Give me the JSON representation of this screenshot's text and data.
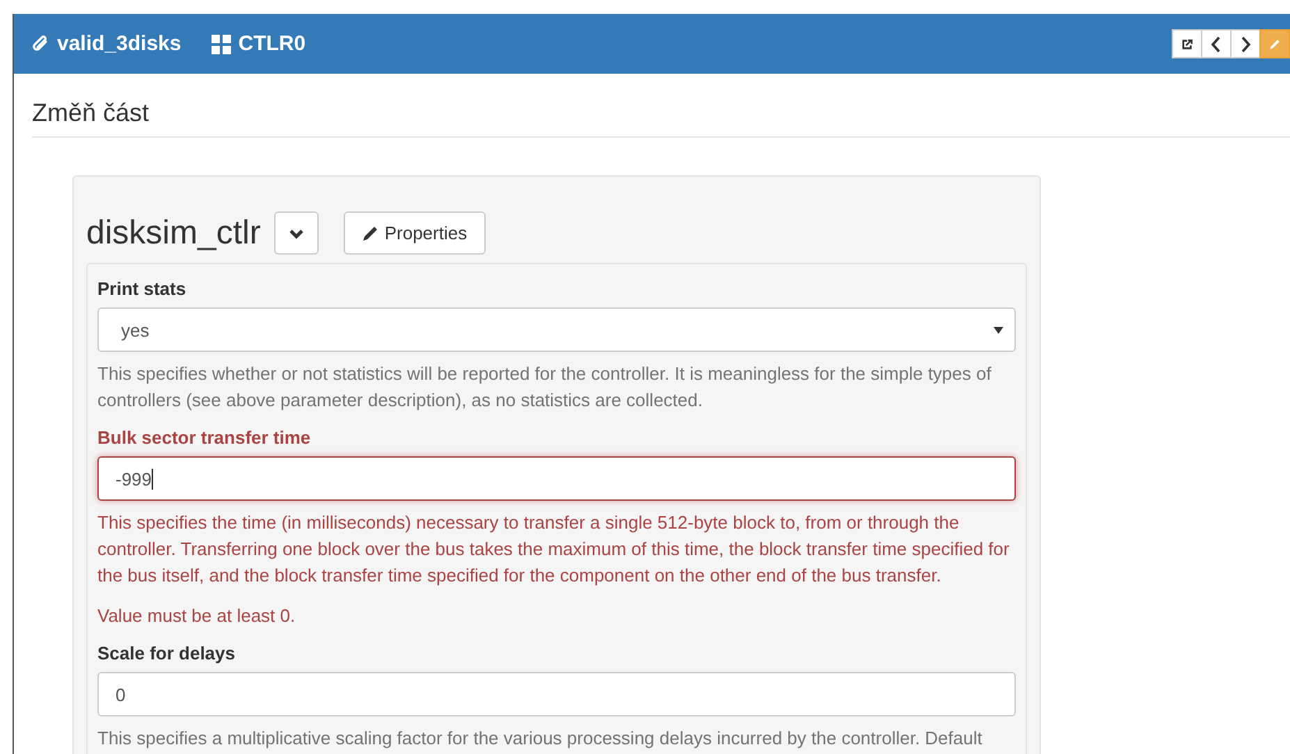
{
  "header": {
    "project": "valid_3disks",
    "component": "CTLR0"
  },
  "page_title": "Změň část",
  "panel": {
    "name": "disksim_ctlr",
    "properties_button": "Properties"
  },
  "fields": [
    {
      "kind": "select",
      "label": "Print stats",
      "value": "yes",
      "error": false,
      "help": "This specifies whether or not statistics will be reported for the controller. It is meaningless for the simple types of controllers (see above parameter description), as no statistics are collected."
    },
    {
      "kind": "text",
      "label": "Bulk sector transfer time",
      "value": "-999",
      "error": true,
      "focused": true,
      "help": "This specifies the time (in milliseconds) necessary to transfer a single 512-byte block to, from or through the controller. Transferring one block over the bus takes the maximum of this time, the block transfer time specified for the bus itself, and the block transfer time specified for the component on the other end of the bus transfer.",
      "error_message": "Value must be at least 0."
    },
    {
      "kind": "text",
      "label": "Scale for delays",
      "value": "0",
      "error": false,
      "focused": false,
      "help": "This specifies a multiplicative scaling factor for the various processing delays incurred by the controller. Default"
    }
  ]
}
